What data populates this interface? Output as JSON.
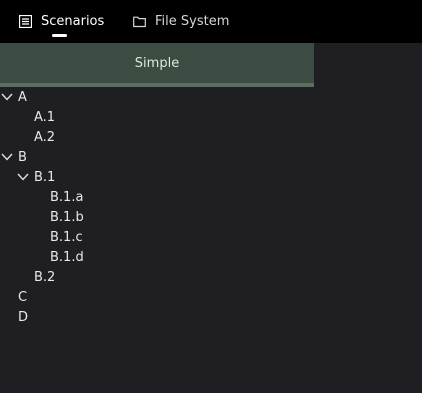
{
  "tabs": [
    {
      "label": "Scenarios",
      "icon": "list-icon",
      "active": true
    },
    {
      "label": "File System",
      "icon": "folder-icon",
      "active": false
    }
  ],
  "panel": {
    "title": "Simple"
  },
  "tree": [
    {
      "label": "A",
      "expanded": true
    },
    {
      "label": "A.1"
    },
    {
      "label": "A.2"
    },
    {
      "label": "B",
      "expanded": true
    },
    {
      "label": "B.1",
      "expanded": true
    },
    {
      "label": "B.1.a"
    },
    {
      "label": "B.1.b"
    },
    {
      "label": "B.1.c"
    },
    {
      "label": "B.1.d"
    },
    {
      "label": "B.2"
    },
    {
      "label": "C"
    },
    {
      "label": "D"
    }
  ],
  "colors": {
    "background": "#1f1f23",
    "topbar": "#000000",
    "panel_header": "#3d4c42",
    "panel_divider": "#5c6e61"
  }
}
